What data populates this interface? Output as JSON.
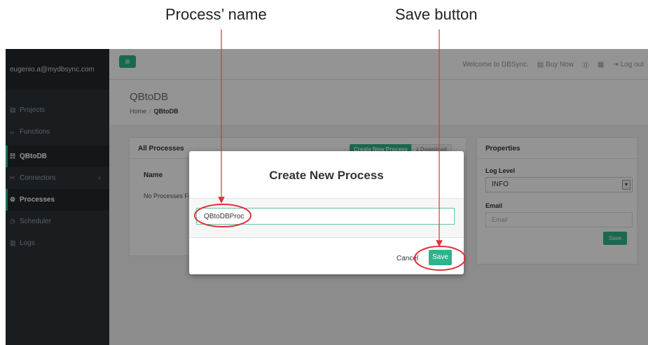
{
  "captions": {
    "process_name": "Process’ name",
    "save_button": "Save button"
  },
  "sidebar": {
    "user": "eugenio.a@mydbsync.com",
    "items": [
      {
        "label": "Projects",
        "icon": "list-icon",
        "glyph": "▤"
      },
      {
        "label": "Functions",
        "icon": "code-icon",
        "glyph": "‹›"
      },
      {
        "label": "QBtoDB",
        "icon": "grid-icon",
        "glyph": "☷"
      },
      {
        "label": "Connectors",
        "icon": "plug-icon",
        "glyph": "✂"
      },
      {
        "label": "Processes",
        "icon": "cogs-icon",
        "glyph": "⚙"
      },
      {
        "label": "Scheduler",
        "icon": "clock-icon",
        "glyph": "◷"
      },
      {
        "label": "Logs",
        "icon": "file-icon",
        "glyph": "▥"
      }
    ],
    "connectors_chevron": "‹"
  },
  "topbar": {
    "menu_glyph": "≡",
    "welcome": "Welcome to DBSync.",
    "buy_now": "Buy Now",
    "buy_icon": "▤",
    "info_icon": "⓪",
    "book_icon": "▦",
    "logout_icon": "⇥",
    "logout": "Log out"
  },
  "page": {
    "title": "QBtoDB",
    "breadcrumb_home": "Home",
    "breadcrumb_sep": "/",
    "breadcrumb_current": "QBtoDB"
  },
  "all_processes": {
    "header": "All Processes",
    "create_btn": "Create New Process",
    "download_btn": "⤓ Download",
    "col_name": "Name",
    "empty": "No Processes Found"
  },
  "properties": {
    "header": "Properties",
    "log_level_label": "Log Level",
    "log_level_value": "INFO",
    "email_label": "Email",
    "email_placeholder": "Email",
    "save": "Save"
  },
  "modal": {
    "title": "Create New Process",
    "input_value": "QBtoDBProc",
    "cancel": "Cancel",
    "save": "Save"
  },
  "colors": {
    "accent": "#2fb38c",
    "sidebar": "#2c3238",
    "annotation": "#e0303a"
  }
}
